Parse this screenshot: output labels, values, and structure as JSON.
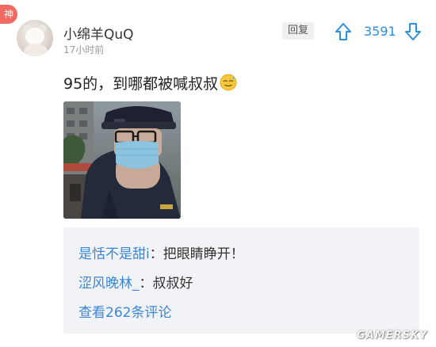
{
  "badge": {
    "label": "神"
  },
  "post": {
    "username": "小绵羊QuQ",
    "timestamp": "17小时前",
    "content": "95的，到哪都被喊叔叔"
  },
  "actions": {
    "reply_label": "回复",
    "vote_count": "3591"
  },
  "comments": {
    "items": [
      {
        "name": "是恬不是甜i",
        "separator": "：",
        "text": "把眼睛睁开！"
      },
      {
        "name": "涩风晚林_",
        "separator": "：",
        "text": "叔叔好"
      }
    ],
    "view_more": "查看262条评论"
  },
  "watermark": "GAMERSKY",
  "colors": {
    "accent_blue": "#2b8fe0",
    "link_blue": "#3a86d6",
    "badge_red": "#f06a63",
    "comment_bg": "#f2f3f7"
  },
  "icons": {
    "up": "arrow-up-icon",
    "down": "arrow-down-icon",
    "emoji": "sweat-smile-emoji"
  }
}
